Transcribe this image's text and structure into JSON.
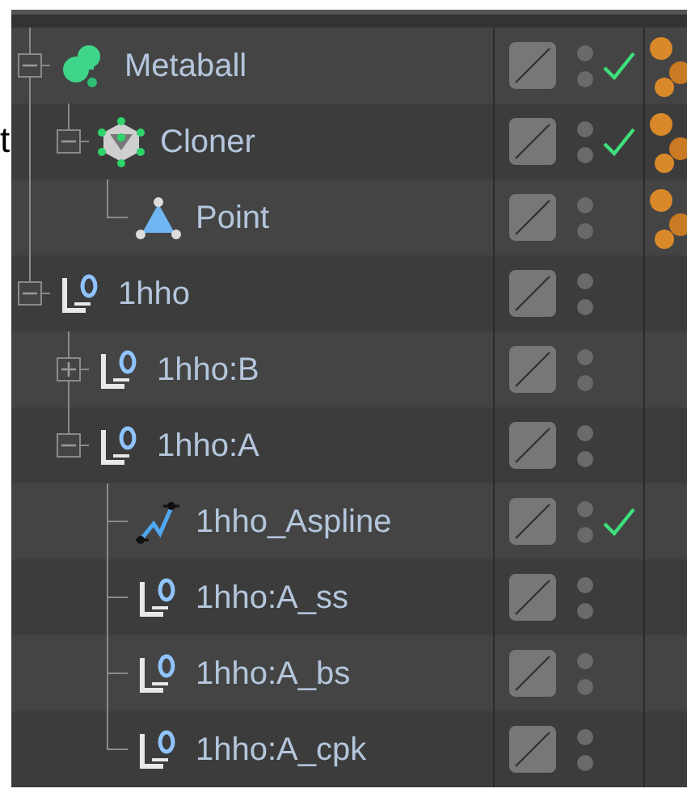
{
  "side_text": "t",
  "tree": [
    {
      "label": "Metaball",
      "kind": "metaball",
      "expanded": true,
      "enabled": true,
      "material_tag": true,
      "children": [
        {
          "label": "Cloner",
          "kind": "cloner",
          "expanded": true,
          "enabled": true,
          "material_tag": true,
          "children": [
            {
              "label": "Point",
              "kind": "point",
              "enabled": false,
              "material_tag": true
            }
          ]
        }
      ]
    },
    {
      "label": "1hho",
      "kind": "null",
      "expanded": true,
      "enabled": false,
      "material_tag": false,
      "children": [
        {
          "label": "1hho:B",
          "kind": "null",
          "expanded": false,
          "enabled": false,
          "material_tag": false
        },
        {
          "label": "1hho:A",
          "kind": "null",
          "expanded": true,
          "enabled": false,
          "material_tag": false,
          "children": [
            {
              "label": "1hho_Aspline",
              "kind": "spline",
              "enabled": true,
              "material_tag": false
            },
            {
              "label": "1hho:A_ss",
              "kind": "null",
              "enabled": false,
              "material_tag": false
            },
            {
              "label": "1hho:A_bs",
              "kind": "null",
              "enabled": false,
              "material_tag": false
            },
            {
              "label": "1hho:A_cpk",
              "kind": "null",
              "enabled": false,
              "material_tag": false
            }
          ]
        }
      ]
    }
  ]
}
